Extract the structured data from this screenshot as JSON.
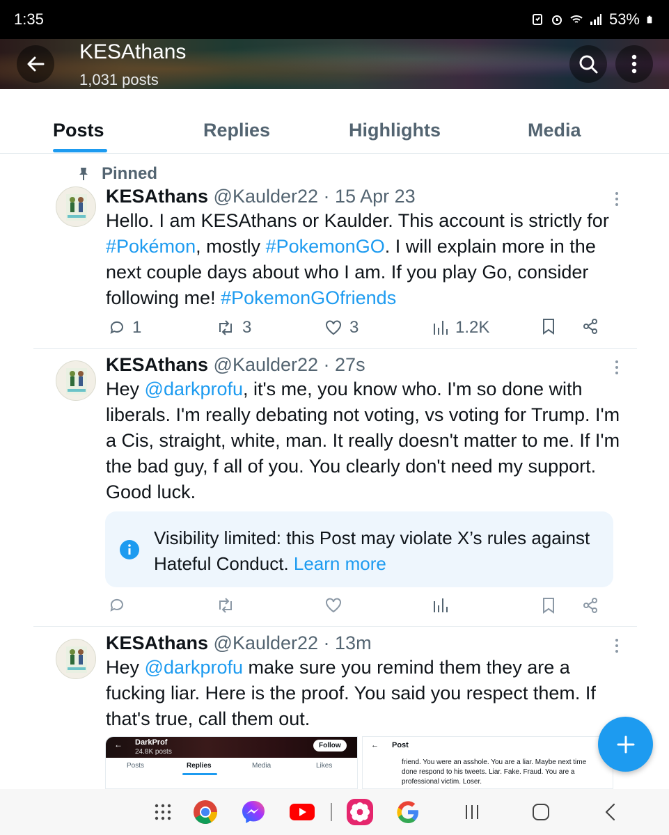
{
  "status_bar": {
    "time": "1:35",
    "battery": "53%"
  },
  "profile": {
    "name": "KESAthans",
    "post_count": "1,031 posts"
  },
  "tabs": [
    {
      "label": "Posts",
      "active": true
    },
    {
      "label": "Replies",
      "active": false
    },
    {
      "label": "Highlights",
      "active": false
    },
    {
      "label": "Media",
      "active": false
    }
  ],
  "pinned_label": "Pinned",
  "posts": [
    {
      "name": "KESAthans",
      "handle": "@Kaulder22 · 15 Apr 23",
      "text_parts": {
        "p1": "Hello. I am KESAthans or Kaulder. This account is strictly for ",
        "tag1": "#Pokémon",
        "p2": ", mostly ",
        "tag2": "#PokemonGO",
        "p3": ". I will explain more in the next couple days about who I am. If you play Go, consider following me! ",
        "tag3": "#PokemonGOfriends"
      },
      "replies": "1",
      "reposts": "3",
      "likes": "3",
      "views": "1.2K"
    },
    {
      "name": "KESAthans",
      "handle": "@Kaulder22 · 27s",
      "text_parts": {
        "p1": "Hey ",
        "mention": "@darkprofu",
        "p2": ", it's me, you know who. I'm so done with liberals. I'm really debating not voting, vs voting for Trump. I'm a Cis, straight, white, man. It really doesn't matter to me. If I'm the bad guy, f all of you. You clearly don't need my support. Good luck."
      },
      "notice": {
        "text": "Visibility limited: this Post may violate X’s rules against Hateful Conduct. ",
        "link": "Learn more"
      }
    },
    {
      "name": "KESAthans",
      "handle": "@Kaulder22 · 13m",
      "text_parts": {
        "p1": "Hey ",
        "mention": "@darkprofu",
        "p2": " make sure you remind them they are a fucking liar. Here is the proof. You said you respect them. If that's true, call them out."
      },
      "media1": {
        "name": "DarkProf",
        "posts": "24.8K posts",
        "follow": "Follow",
        "tabs": [
          "Posts",
          "Replies",
          "Media",
          "Likes"
        ]
      },
      "media2": {
        "title": "Post",
        "text": "friend. You were an asshole. You are a liar. Maybe next time done respond to his tweets. Liar. Fake. Fraud. You are a professional victim. Loser."
      }
    }
  ],
  "colors": {
    "accent": "#1d9bf0",
    "muted": "#536471",
    "notice_bg": "#eef6fd"
  }
}
